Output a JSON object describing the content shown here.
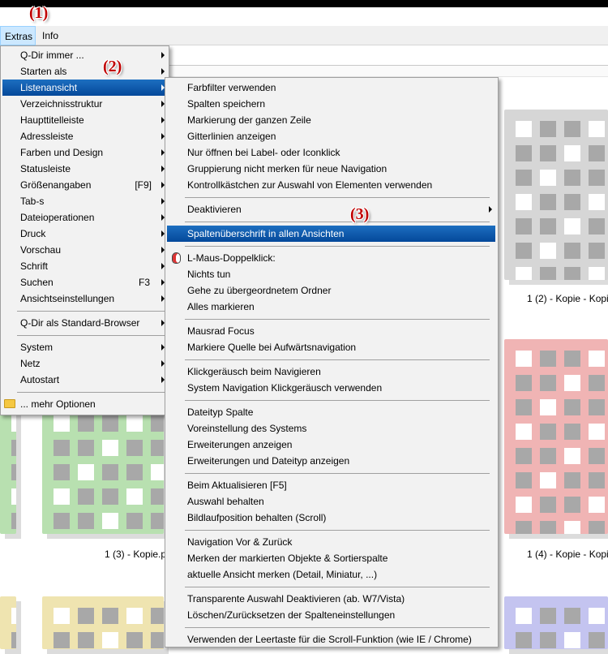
{
  "annotations": {
    "a1": "(1)",
    "a2": "(2)",
    "a3": "(3)"
  },
  "menubar": {
    "extras": "Extras",
    "info": "Info"
  },
  "menu1": {
    "items": [
      {
        "label": "Q-Dir immer ...",
        "arrow": true
      },
      {
        "label": "Starten als",
        "arrow": true
      },
      {
        "label": "Listenansicht",
        "arrow": true,
        "highlighted": true
      },
      {
        "label": "Verzeichnisstruktur",
        "arrow": true
      },
      {
        "label": "Haupttitelleiste",
        "arrow": true
      },
      {
        "label": "Adressleiste",
        "arrow": true
      },
      {
        "label": "Farben und Design",
        "arrow": true
      },
      {
        "label": "Statusleiste",
        "arrow": true
      },
      {
        "label": "Größenangaben",
        "shortcut": "[F9]",
        "arrow": true
      },
      {
        "label": "Tab-s",
        "arrow": true
      },
      {
        "label": "Dateioperationen",
        "arrow": true
      },
      {
        "label": "Druck",
        "arrow": true
      },
      {
        "label": "Vorschau",
        "arrow": true
      },
      {
        "label": "Schrift",
        "arrow": true
      },
      {
        "label": "Suchen",
        "shortcut": "F3",
        "arrow": true
      },
      {
        "label": "Ansichtseinstellungen",
        "arrow": true
      },
      {
        "label": "Q-Dir als Standard-Browser",
        "arrow": true
      },
      {
        "label": "System",
        "arrow": true
      },
      {
        "label": "Netz",
        "arrow": true
      },
      {
        "label": "Autostart",
        "arrow": true
      },
      {
        "label": "... mehr Optionen",
        "icon": "folder-icon"
      }
    ]
  },
  "menu2": {
    "items": [
      {
        "label": "Farbfilter verwenden"
      },
      {
        "label": "Spalten speichern"
      },
      {
        "label": "Markierung der ganzen Zeile"
      },
      {
        "label": "Gitterlinien anzeigen"
      },
      {
        "label": "Nur öffnen bei Label- oder Iconklick"
      },
      {
        "label": "Gruppierung nicht merken für neue Navigation"
      },
      {
        "label": "Kontrollkästchen zur Auswahl von Elementen verwenden"
      },
      {
        "label": "Deaktivieren",
        "arrow": true
      },
      {
        "label": "Spaltenüberschrift in allen Ansichten",
        "highlighted": true
      },
      {
        "label": "L-Maus-Doppelklick:",
        "icon": "mouse-icon"
      },
      {
        "label": "Nichts tun"
      },
      {
        "label": "Gehe zu übergeordnetem Ordner"
      },
      {
        "label": "Alles markieren"
      },
      {
        "label": "Mausrad Focus"
      },
      {
        "label": "Markiere Quelle bei Aufwärtsnavigation"
      },
      {
        "label": "Klickgeräusch beim Navigieren"
      },
      {
        "label": "System Navigation Klickgeräusch verwenden"
      },
      {
        "label": "Dateityp Spalte"
      },
      {
        "label": "Voreinstellung des Systems"
      },
      {
        "label": "Erweiterungen anzeigen"
      },
      {
        "label": "Erweiterungen und Dateityp anzeigen"
      },
      {
        "label": "Beim Aktualisieren [F5]"
      },
      {
        "label": "Auswahl behalten"
      },
      {
        "label": "Bildlaufposition behalten (Scroll)"
      },
      {
        "label": "Navigation Vor & Zurück"
      },
      {
        "label": "Merken der markierten Objekte & Sortierspalte"
      },
      {
        "label": "aktuelle Ansicht merken (Detail, Miniatur, ...)"
      },
      {
        "label": "Transparente Auswahl Deaktivieren (ab. W7/Vista)"
      },
      {
        "label": "Löschen/Zurücksetzen der Spalteneinstellungen"
      },
      {
        "label": "Verwenden der Leertaste für die Scroll-Funktion (wie IE / Chrome)"
      }
    ]
  },
  "files": {
    "caption_2": "1 (2) - Kopie - Kopi",
    "caption_3": "1 (3) - Kopie.p",
    "caption_4": "1 (4) - Kopie - Kopi"
  },
  "colors": {
    "gray_thumb": "#d6d6d6",
    "red_thumb": "#f0b4b4",
    "green_thumb": "#b8e0b0",
    "yellow_thumb": "#efe4b0",
    "blue_thumb": "#c4c4f0",
    "thumb_square": "#a8a8a8",
    "highlight": "#0a58a7"
  }
}
